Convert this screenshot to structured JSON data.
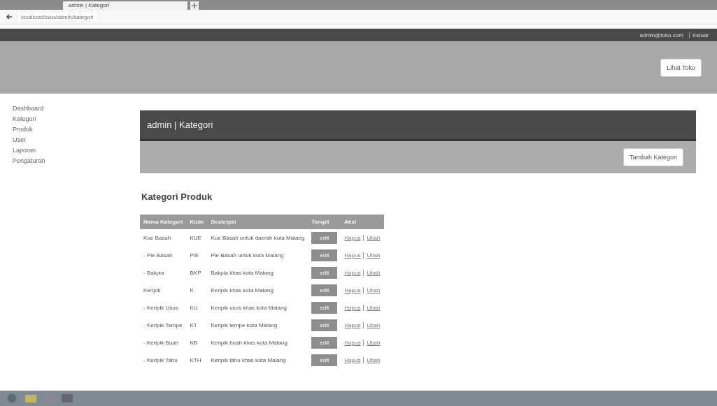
{
  "browser": {
    "tab_title": "admin | Kategori",
    "address": "localhost/toko/admin/kategori"
  },
  "navbar": {
    "user": "admin@toko.com",
    "logout": "Keluar"
  },
  "header": {
    "button": "Lihat Toko"
  },
  "sidebar": {
    "items": [
      {
        "label": "Dashboard"
      },
      {
        "label": "Kategori"
      },
      {
        "label": "Produk"
      },
      {
        "label": "User"
      },
      {
        "label": "Laporan"
      },
      {
        "label": "Pengaturan"
      }
    ]
  },
  "panel": {
    "title": "admin | Kategori",
    "button": "Tambah Kategori"
  },
  "section_title": "Kategori Produk",
  "table": {
    "columns": [
      "Nama Kategori",
      "Kode",
      "Deskripsi",
      "Tampil",
      "Aksi"
    ],
    "rows": [
      {
        "name": "Kue Basah",
        "code": "KUE",
        "description": "Kue Basah untuk daerah kota Malang",
        "button": "edit",
        "edit": "Ubah",
        "delete": "Hapus"
      },
      {
        "name": "- Pie Basah",
        "code": "PIE",
        "description": "Pie Basah untuk kota Malang",
        "button": "edit",
        "edit": "Ubah",
        "delete": "Hapus"
      },
      {
        "name": "- Bakpia",
        "code": "BKP",
        "description": "Bakpia khas kota Malang",
        "button": "edit",
        "edit": "Ubah",
        "delete": "Hapus"
      },
      {
        "name": "Keripik",
        "code": "K",
        "description": "Keripik khas kota Malang",
        "button": "edit",
        "edit": "Ubah",
        "delete": "Hapus"
      },
      {
        "name": "- Keripik Usus",
        "code": "KU",
        "description": "Keripik usus khas kota Malang",
        "button": "edit",
        "edit": "Ubah",
        "delete": "Hapus"
      },
      {
        "name": "- Keripik Tempe",
        "code": "KT",
        "description": "Keripik tempe kota Malang",
        "button": "edit",
        "edit": "Ubah",
        "delete": "Hapus"
      },
      {
        "name": "- Keripik Buah",
        "code": "KB",
        "description": "Keripik buah khas kota Malang",
        "button": "edit",
        "edit": "Ubah",
        "delete": "Hapus"
      },
      {
        "name": "- Keripik Tahu",
        "code": "KTH",
        "description": "Keripik tahu khas kota Malang",
        "button": "edit",
        "edit": "Ubah",
        "delete": "Hapus"
      }
    ]
  }
}
